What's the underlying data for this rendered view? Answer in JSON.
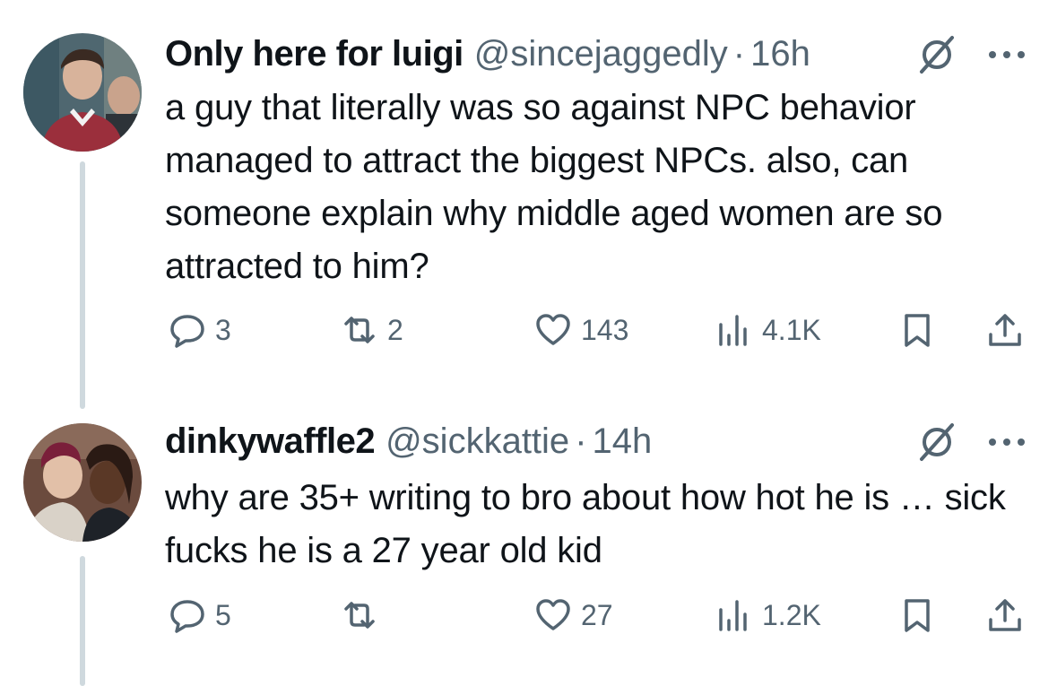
{
  "tweets": [
    {
      "display_name": "Only here for luigi",
      "handle": "@sincejaggedly",
      "separator": "·",
      "time": "16h",
      "text": "a guy that literally was so against NPC behavior managed to attract the biggest NPCs. also, can someone explain why middle aged women are so attracted to him?",
      "replies": "3",
      "reposts": "2",
      "likes": "143",
      "views": "4.1K"
    },
    {
      "display_name": "dinkywaffle2",
      "handle": "@sickkattie",
      "separator": "·",
      "time": "14h",
      "text": "why are 35+ writing to bro about how hot he is … sick fucks he is a 27 year old kid",
      "replies": "5",
      "reposts": "",
      "likes": "27",
      "views": "1.2K"
    }
  ],
  "icons": {
    "reply": "reply-icon",
    "repost": "repost-icon",
    "like": "heart-icon",
    "views": "views-icon",
    "bookmark": "bookmark-icon",
    "share": "share-icon",
    "grok": "grok-icon",
    "more": "more-icon"
  },
  "colors": {
    "text": "#0f1419",
    "secondary": "#536471",
    "thread_line": "#cfd9de"
  }
}
